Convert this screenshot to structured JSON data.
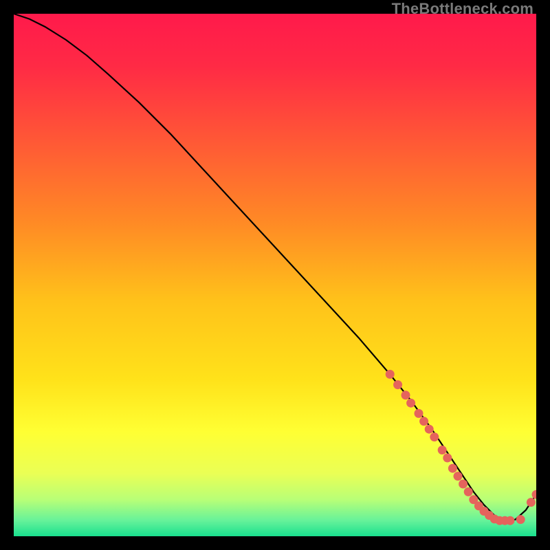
{
  "watermark": "TheBottleneck.com",
  "chart_data": {
    "type": "line",
    "title": "",
    "xlabel": "",
    "ylabel": "",
    "xlim": [
      0,
      100
    ],
    "ylim": [
      0,
      100
    ],
    "grid": false,
    "legend": false,
    "gradient_stops": [
      {
        "offset": 0.0,
        "color": "#ff1a4b"
      },
      {
        "offset": 0.1,
        "color": "#ff2a45"
      },
      {
        "offset": 0.25,
        "color": "#ff5a35"
      },
      {
        "offset": 0.4,
        "color": "#ff8a25"
      },
      {
        "offset": 0.55,
        "color": "#ffc21a"
      },
      {
        "offset": 0.7,
        "color": "#ffe21a"
      },
      {
        "offset": 0.8,
        "color": "#ffff33"
      },
      {
        "offset": 0.88,
        "color": "#eaff55"
      },
      {
        "offset": 0.93,
        "color": "#b8ff77"
      },
      {
        "offset": 0.97,
        "color": "#66f29a"
      },
      {
        "offset": 1.0,
        "color": "#19e08e"
      }
    ],
    "series": [
      {
        "name": "bottleneck-curve",
        "type": "line",
        "color": "#000000",
        "x": [
          0,
          3,
          6,
          10,
          14,
          18,
          24,
          30,
          36,
          42,
          48,
          54,
          60,
          66,
          72,
          76,
          80,
          83,
          86,
          88,
          90,
          92,
          94,
          96,
          98,
          100
        ],
        "y": [
          100,
          99,
          97.5,
          95,
          92,
          88.5,
          83,
          77,
          70.5,
          64,
          57.5,
          51,
          44.5,
          38,
          31,
          26,
          20.5,
          16,
          11.5,
          8.5,
          6,
          4,
          3,
          3.2,
          5,
          8
        ]
      },
      {
        "name": "sample-points",
        "type": "scatter",
        "color": "#e5645c",
        "x": [
          72,
          73.5,
          75,
          76,
          77.5,
          78.5,
          79.5,
          80.5,
          82,
          83,
          84,
          85,
          86,
          87,
          88,
          89,
          90,
          91,
          92,
          93,
          94,
          95,
          97,
          99,
          100
        ],
        "y": [
          31,
          29,
          27,
          25.5,
          23.5,
          22,
          20.5,
          19,
          16.5,
          15,
          13,
          11.5,
          10,
          8.5,
          7,
          5.8,
          4.8,
          4,
          3.3,
          3,
          3,
          3,
          3.2,
          6.5,
          8
        ]
      }
    ]
  }
}
